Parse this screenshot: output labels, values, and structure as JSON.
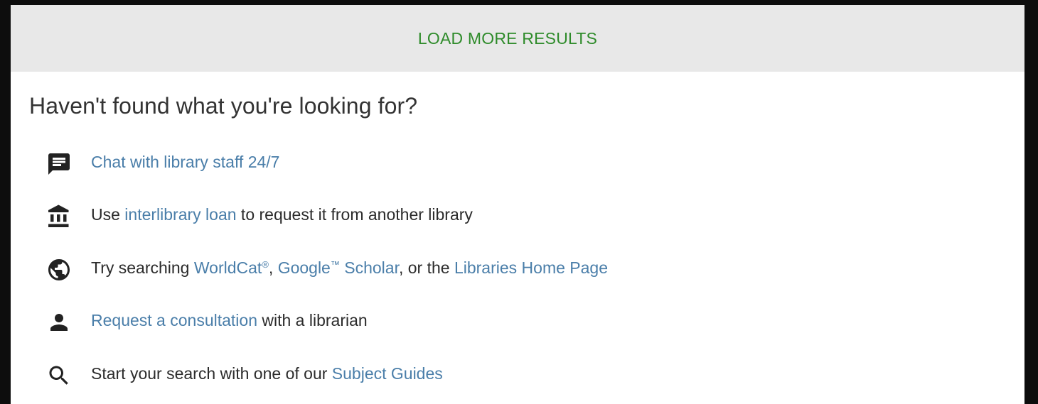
{
  "load_more": {
    "label": "LOAD MORE RESULTS"
  },
  "heading": "Haven't found what you're looking for?",
  "options": {
    "chat": {
      "link": "Chat with library staff 24/7"
    },
    "ill": {
      "prefix": "Use ",
      "link": "interlibrary loan",
      "suffix": " to request it from another library"
    },
    "search": {
      "prefix": "Try searching ",
      "worldcat": "WorldCat",
      "reg": "®",
      "sep1": ", ",
      "google": "Google",
      "tm": "™",
      "scholar": " Scholar",
      "sep2": ", or the ",
      "libraries": "Libraries Home Page"
    },
    "consult": {
      "link": "Request a consultation",
      "suffix": " with a librarian"
    },
    "guides": {
      "prefix": "Start your search with one of our ",
      "link": "Subject Guides"
    }
  },
  "icons": {
    "chat": "chat-bubble-icon",
    "ill": "library-building-icon",
    "search": "globe-icon",
    "consult": "person-icon",
    "guides": "search-icon"
  },
  "colors": {
    "load_more_text": "#2e8b2a",
    "load_more_bg": "#e8e8e8",
    "link": "#4a7ea9",
    "text": "#2b2b2b",
    "icon": "#222222"
  }
}
